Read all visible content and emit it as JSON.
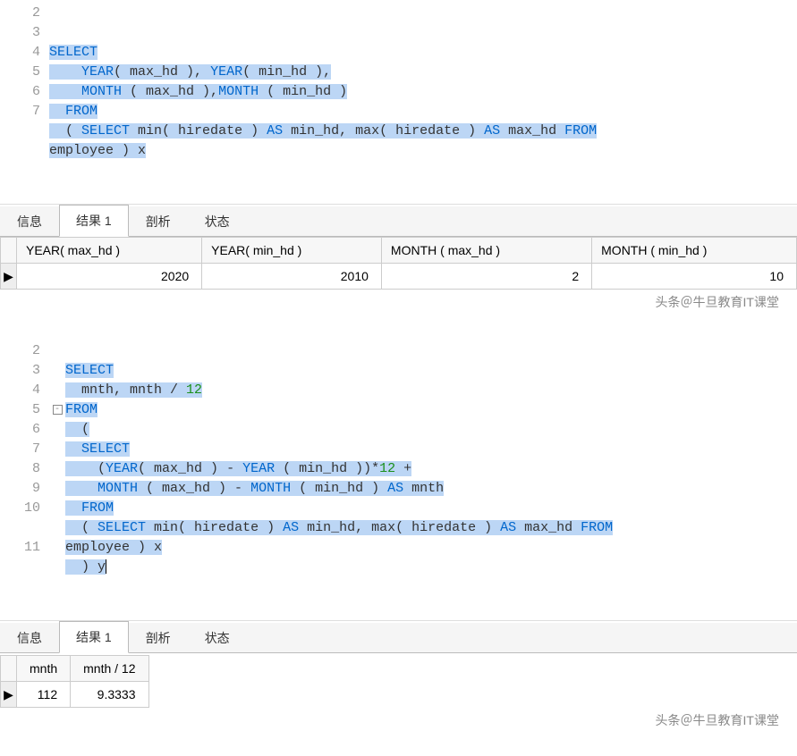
{
  "block1": {
    "line_numbers": [
      "2",
      "3",
      "4",
      "5",
      "6",
      "7",
      ""
    ],
    "code": {
      "l3_select": "SELECT",
      "l4_year": "YEAR",
      "l4_maxhd": "( max_hd ), ",
      "l4_year2": "YEAR",
      "l4_minhd": "( min_hd ),",
      "l5_month": "MONTH",
      "l5_maxhd": " ( max_hd ),",
      "l5_month2": "MONTH",
      "l5_minhd": " ( min_hd )",
      "l6_from": "FROM",
      "l7_open": "( ",
      "l7_select": "SELECT",
      "l7_min": " min( hiredate ) ",
      "l7_as1": "AS",
      "l7_minhd": " min_hd, max( hiredate ) ",
      "l7_as2": "AS",
      "l7_maxhd": " max_hd ",
      "l7_from": "FROM",
      "l7b_tail": "employee ) x"
    },
    "tabs": {
      "info": "信息",
      "result": "结果 1",
      "profile": "剖析",
      "status": "状态"
    },
    "headers": [
      "YEAR( max_hd )",
      "YEAR( min_hd )",
      "MONTH ( max_hd )",
      "MONTH ( min_hd )"
    ],
    "row": [
      "2020",
      "2010",
      "2",
      "10"
    ],
    "watermark": "头条＠牛旦教育IT课堂"
  },
  "block2": {
    "line_numbers": [
      "2",
      "3",
      "4",
      "5",
      "6",
      "7",
      "8",
      "9",
      "10",
      "",
      "11"
    ],
    "fold": {
      "at5": "-"
    },
    "code": {
      "l2_select": "SELECT",
      "l3_body": "mnth, mnth / ",
      "l3_num": "12",
      "l4_from": "FROM",
      "l5_open": "(",
      "l6_select": "SELECT",
      "l7_open": "(",
      "l7_year": "YEAR",
      "l7_max": "( max_hd ) - ",
      "l7_year2": "YEAR",
      "l7_min": " ( min_hd ))*",
      "l7_num": "12",
      "l7_plus": " +",
      "l8_month": "MONTH",
      "l8_max": " ( max_hd ) - ",
      "l8_month2": "MONTH",
      "l8_min": " ( min_hd ) ",
      "l8_as": "AS",
      "l8_alias": " mnth",
      "l9_from": "FROM",
      "l10_open": "( ",
      "l10_select": "SELECT",
      "l10_min": " min( hiredate ) ",
      "l10_as1": "AS",
      "l10_minhd": " min_hd, max( hiredate ) ",
      "l10_as2": "AS",
      "l10_maxhd": " max_hd ",
      "l10_from": "FROM",
      "l10b_tail": "employee ) x",
      "l11_close": ") y"
    },
    "tabs": {
      "info": "信息",
      "result": "结果 1",
      "profile": "剖析",
      "status": "状态"
    },
    "headers": [
      "mnth",
      "mnth / 12"
    ],
    "row": [
      "112",
      "9.3333"
    ],
    "watermark": "头条＠牛旦教育IT课堂"
  },
  "chart_data": [
    {
      "type": "table",
      "title": "结果 1",
      "columns": [
        "YEAR( max_hd )",
        "YEAR( min_hd )",
        "MONTH ( max_hd )",
        "MONTH ( min_hd )"
      ],
      "rows": [
        [
          2020,
          2010,
          2,
          10
        ]
      ]
    },
    {
      "type": "table",
      "title": "结果 1",
      "columns": [
        "mnth",
        "mnth / 12"
      ],
      "rows": [
        [
          112,
          9.3333
        ]
      ]
    }
  ]
}
